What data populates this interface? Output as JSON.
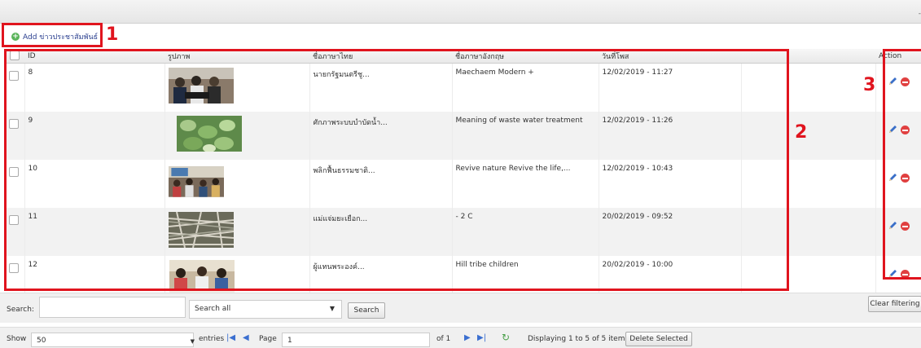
{
  "toolbar": {
    "corner_mark": "-"
  },
  "add_link": {
    "label": "Add ข่าวประชาสัมพันธ์"
  },
  "annotations": {
    "one": "1",
    "two": "2",
    "three": "3"
  },
  "table": {
    "headers": {
      "id": "ID",
      "image": "รูปภาพ",
      "name_th": "ชื่อภาษาไทย",
      "name_en": "ชื่อภาษาอังกฤษ",
      "date": "วันที่โพส",
      "action": "Action"
    },
    "rows": [
      {
        "id": "8",
        "name_th": "นายกรัฐมนตรีชู...",
        "name_en": "Maechaem Modern +",
        "date": "12/02/2019 - 11:27"
      },
      {
        "id": "9",
        "name_th": "ศักภาพระบบบำบัดน้ำ...",
        "name_en": "Meaning of waste water treatment",
        "date": "12/02/2019 - 11:26"
      },
      {
        "id": "10",
        "name_th": "พลิกฟื้นธรรมชาติ...",
        "name_en": "Revive nature Revive the life,...",
        "date": "12/02/2019 - 10:43"
      },
      {
        "id": "11",
        "name_th": "แม่แจ่มยะเยือก...",
        "name_en": "- 2 C",
        "date": "20/02/2019 - 09:52"
      },
      {
        "id": "12",
        "name_th": "ผู้แทนพระองค์...",
        "name_en": "Hill tribe children",
        "date": "20/02/2019 - 10:00"
      }
    ]
  },
  "search": {
    "label": "Search:",
    "value": "",
    "scope_selected": "Search all",
    "button": "Search",
    "clear": "Clear filtering"
  },
  "pager": {
    "show_label": "Show",
    "entries_value": "50",
    "entries_label": "entries",
    "page_label": "Page",
    "page_value": "1",
    "of_label": "of 1",
    "status": "Displaying 1 to 5 of 5 items",
    "delete_selected": "Delete Selected"
  },
  "colors": {
    "annotation": "#e0141e",
    "link": "#2a3f8f",
    "row_alt": "#f2f2f2"
  }
}
